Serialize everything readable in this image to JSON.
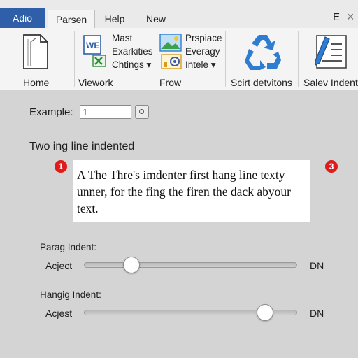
{
  "tabs": {
    "active": "Adio",
    "selected": "Parsen",
    "help": "Help",
    "new": "New",
    "corner": "E",
    "close": "×"
  },
  "ribbon": {
    "home_label": "Home",
    "viework_label": "Viework",
    "viework_items": [
      "Mast",
      "Exarkities",
      "Chtings ▾"
    ],
    "frow_label": "Frow",
    "frow_items": [
      "Prspiace",
      "Everagy",
      "Intele ▾"
    ],
    "scirt_label": "Scirt detvitons",
    "salev_label": "Salev Indent",
    "icons": [
      "document-icon",
      "word-doc-icon",
      "excel-icon",
      "picture-icon",
      "chart-icon",
      "recycle-icon",
      "pen-document-icon"
    ]
  },
  "example": {
    "label": "Example:",
    "value": "1"
  },
  "heading": "Two ing line indented",
  "preview": {
    "text": "A The Thre's imdenter first hang line texty unner, for the fing the firen the dack abyour text."
  },
  "markers": {
    "left": "1",
    "right": "3"
  },
  "sliders": [
    {
      "section": "Parag Indent:",
      "label": "Acject",
      "unit": "DN",
      "fraction": 0.2
    },
    {
      "section": "Hangig Indent:",
      "label": "Acjest",
      "unit": "DN",
      "fraction": 0.88
    }
  ],
  "colors": {
    "accent": "#2e5fa8",
    "marker": "#e01b1b",
    "recycle": "#2f7dd1"
  }
}
